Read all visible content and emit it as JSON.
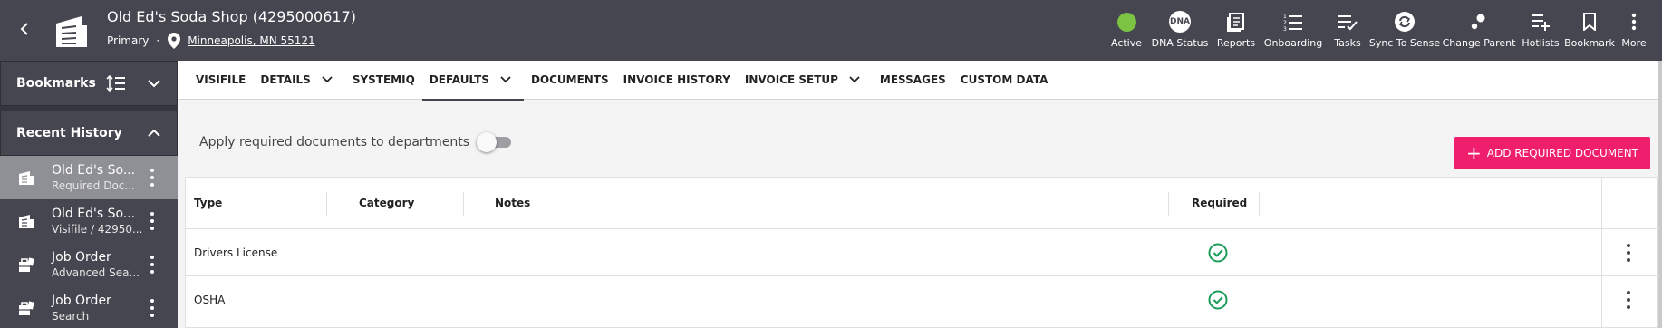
{
  "header": {
    "title": "Old Ed's Soda Shop (4295000617)",
    "type_label": "Primary",
    "separator": "·",
    "address": "Minneapolis, MN 55121",
    "actions": [
      {
        "label": "Active",
        "icon": "status-dot-icon"
      },
      {
        "label": "DNA Status",
        "icon": "dna-icon",
        "icon_text": "DNA"
      },
      {
        "label": "Reports",
        "icon": "reports-icon"
      },
      {
        "label": "Onboarding",
        "icon": "onboarding-icon"
      },
      {
        "label": "Tasks",
        "icon": "tasks-icon"
      },
      {
        "label": "Sync To Sense",
        "icon": "sync-icon"
      },
      {
        "label": "Change Parent",
        "icon": "change-parent-icon"
      },
      {
        "label": "Hotlists",
        "icon": "hotlists-icon"
      },
      {
        "label": "Bookmark",
        "icon": "bookmark-icon"
      },
      {
        "label": "More",
        "icon": "more-icon"
      }
    ]
  },
  "sidebar": {
    "bookmarks_label": "Bookmarks",
    "recent_label": "Recent History",
    "items": [
      {
        "line1": "Old Ed's So...",
        "line2": "Required Doc...",
        "icon": "building-icon",
        "active": true
      },
      {
        "line1": "Old Ed's So...",
        "line2": "Visifile / 42950...",
        "icon": "building-icon",
        "active": false
      },
      {
        "line1": "Job Order",
        "line2": "Advanced Sea...",
        "icon": "job-order-icon",
        "active": false
      },
      {
        "line1": "Job Order",
        "line2": "Search",
        "icon": "job-order-icon",
        "active": false
      }
    ]
  },
  "tabs": [
    {
      "label": "VISIFILE",
      "caret": false,
      "active": false
    },
    {
      "label": "DETAILS",
      "caret": true,
      "active": false
    },
    {
      "label": "SYSTEMIQ",
      "caret": false,
      "active": false
    },
    {
      "label": "DEFAULTS",
      "caret": true,
      "active": true
    },
    {
      "label": "DOCUMENTS",
      "caret": false,
      "active": false
    },
    {
      "label": "INVOICE HISTORY",
      "caret": false,
      "active": false
    },
    {
      "label": "INVOICE SETUP",
      "caret": true,
      "active": false
    },
    {
      "label": "MESSAGES",
      "caret": false,
      "active": false
    },
    {
      "label": "CUSTOM DATA",
      "caret": false,
      "active": false
    }
  ],
  "toggle": {
    "label": "Apply required documents to departments",
    "on": false
  },
  "add_button": {
    "label": "ADD REQUIRED DOCUMENT"
  },
  "table": {
    "columns": {
      "type": "Type",
      "category": "Category",
      "notes": "Notes",
      "required": "Required"
    },
    "rows": [
      {
        "type": "Drivers License",
        "category": "",
        "notes": "",
        "required": true
      },
      {
        "type": "OSHA",
        "category": "",
        "notes": "",
        "required": true
      }
    ]
  },
  "colors": {
    "header_bg": "#45464f",
    "accent": "#ef1f6d",
    "active_status": "#7cc243",
    "required_check": "#1a9c5b"
  }
}
